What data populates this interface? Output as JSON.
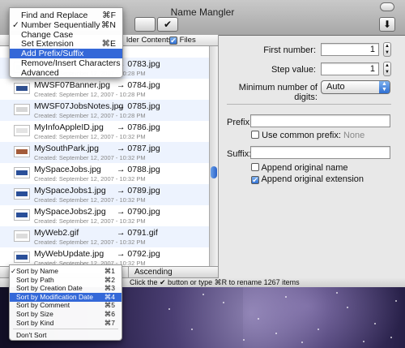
{
  "window": {
    "title": "Name Mangler",
    "apply_button": "✔",
    "download_icon": "download-icon",
    "window_toggle_icon": "window-toggle-icon"
  },
  "list_header": {
    "folder_contents_label": "lder Contents",
    "files_label": "Files",
    "files_checked": true
  },
  "files": [
    {
      "name": "",
      "created": "",
      "new_name": ""
    },
    {
      "name": "",
      "created": "Created: September 12, 2007 - 10:28 PM",
      "new_name": "→ 0783.jpg"
    },
    {
      "name": "MWSF07Banner.jpg",
      "created": "Created: September 12, 2007 - 10:28 PM",
      "new_name": "→ 0784.jpg"
    },
    {
      "name": "MWSF07JobsNotes.jpg",
      "created": "Created: September 12, 2007 - 10:28 PM",
      "new_name": "→ 0785.jpg"
    },
    {
      "name": "MyInfoAppleID.jpg",
      "created": "Created: September 12, 2007 - 10:32 PM",
      "new_name": "→ 0786.jpg"
    },
    {
      "name": "MySouthPark.jpg",
      "created": "Created: September 12, 2007 - 10:32 PM",
      "new_name": "→ 0787.jpg"
    },
    {
      "name": "MySpaceJobs.jpg",
      "created": "Created: September 12, 2007 - 10:32 PM",
      "new_name": "→ 0788.jpg"
    },
    {
      "name": "MySpaceJobs1.jpg",
      "created": "Created: September 12, 2007 - 10:32 PM",
      "new_name": "→ 0789.jpg"
    },
    {
      "name": "MySpaceJobs2.jpg",
      "created": "Created: September 12, 2007 - 10:32 PM",
      "new_name": "→ 0790.jpg"
    },
    {
      "name": "MyWeb2.gif",
      "created": "Created: September 12, 2007 - 10:32 PM",
      "new_name": "→ 0791.gif"
    },
    {
      "name": "MyWebUpdate.jpg",
      "created": "Created: September 12, 2007 - 10:32 PM",
      "new_name": "→ 0792.jpg"
    }
  ],
  "sort_bar": {
    "order": "Ascending"
  },
  "status": {
    "text": "Click the ✔ button or type ⌘R to rename 1267 items"
  },
  "settings": {
    "first_number_label": "First number:",
    "first_number_value": "1",
    "step_value_label": "Step value:",
    "step_value_value": "1",
    "min_digits_label": "Minimum number of digits:",
    "min_digits_value": "Auto",
    "prefix_label": "Prefix:",
    "prefix_value": "",
    "use_common_prefix_label": "Use common prefix:",
    "use_common_prefix_hint": "None",
    "use_common_prefix_checked": false,
    "suffix_label": "Suffix:",
    "suffix_value": "",
    "append_original_name_label": "Append original name",
    "append_original_name_checked": false,
    "append_original_extension_label": "Append original extension",
    "append_original_extension_checked": true
  },
  "action_menu": {
    "items": [
      {
        "label": "Find and Replace",
        "shortcut": "⌘F",
        "checked": false,
        "selected": false
      },
      {
        "label": "Number Sequentially",
        "shortcut": "⌘N",
        "checked": true,
        "selected": false
      },
      {
        "label": "Change Case",
        "shortcut": "",
        "checked": false,
        "selected": false
      },
      {
        "label": "Set Extension",
        "shortcut": "⌘E",
        "checked": false,
        "selected": false
      },
      {
        "label": "Add Prefix/Suffix",
        "shortcut": "",
        "checked": false,
        "selected": true
      },
      {
        "label": "Remove/Insert Characters",
        "shortcut": "",
        "checked": false,
        "selected": false
      },
      {
        "label": "Advanced",
        "shortcut": "",
        "checked": false,
        "selected": false
      }
    ]
  },
  "sort_menu": {
    "items": [
      {
        "label": "Sort by Name",
        "shortcut": "⌘1",
        "checked": true,
        "selected": false
      },
      {
        "label": "Sort by Path",
        "shortcut": "⌘2",
        "checked": false,
        "selected": false
      },
      {
        "label": "Sort by Creation Date",
        "shortcut": "⌘3",
        "checked": false,
        "selected": false
      },
      {
        "label": "Sort by Modification Date",
        "shortcut": "⌘4",
        "checked": false,
        "selected": true
      },
      {
        "label": "Sort by Comment",
        "shortcut": "⌘5",
        "checked": false,
        "selected": false
      },
      {
        "label": "Sort by Size",
        "shortcut": "⌘6",
        "checked": false,
        "selected": false
      },
      {
        "label": "Sort by Kind",
        "shortcut": "⌘7",
        "checked": false,
        "selected": false
      }
    ],
    "dont_sort_label": "Don't Sort"
  },
  "colors": {
    "selection": "#3468d8",
    "alt_row": "#edf3fe"
  }
}
